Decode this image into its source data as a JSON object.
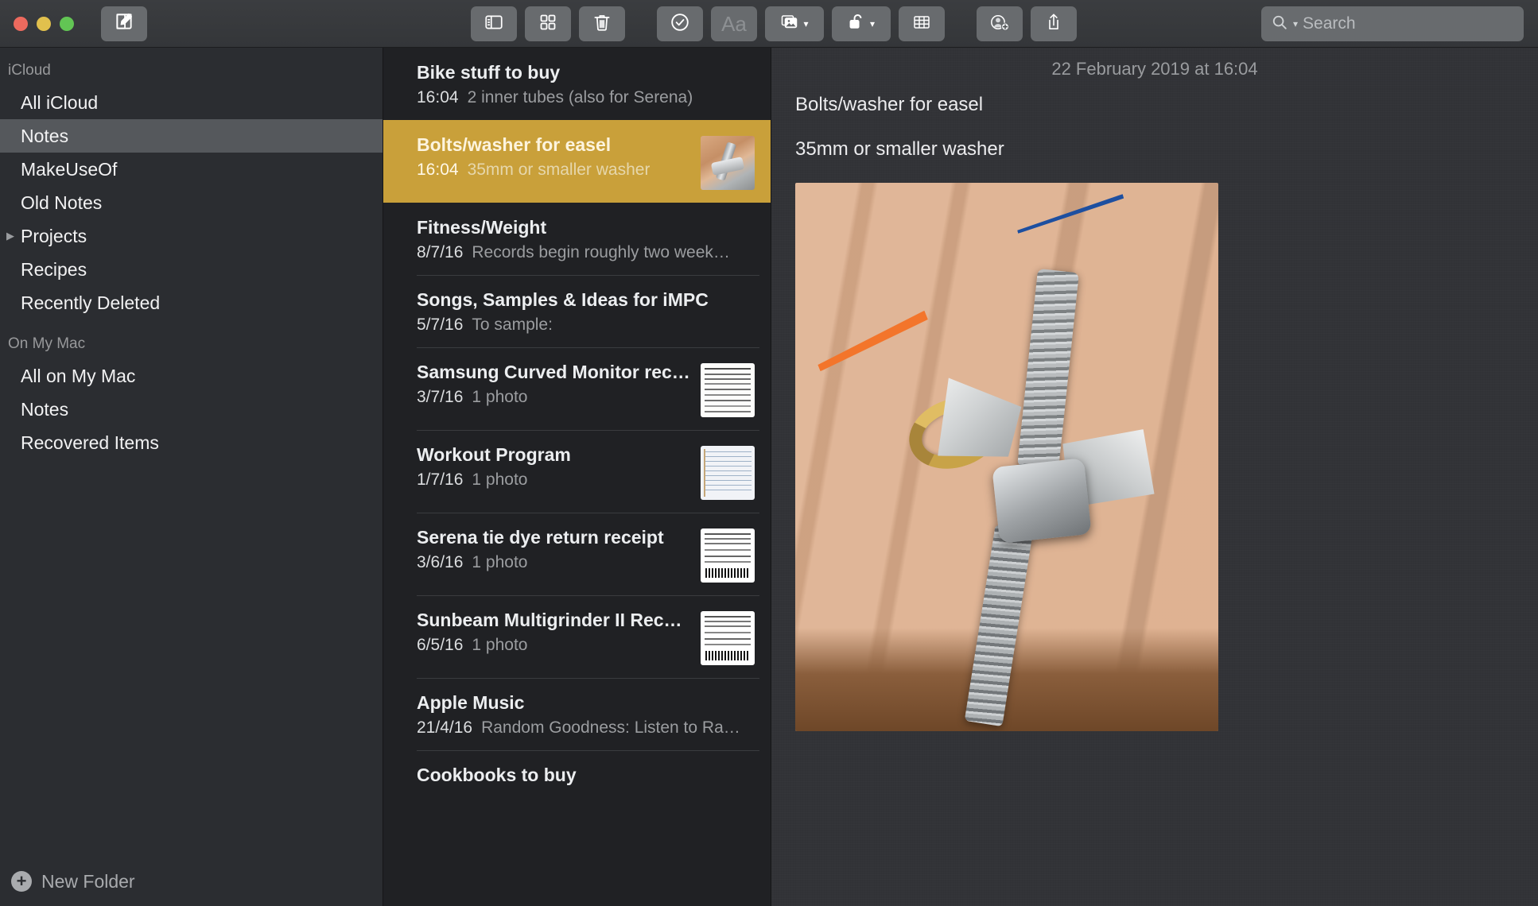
{
  "window": {
    "title": "Notes",
    "traffic_lights": [
      "close",
      "minimize",
      "zoom"
    ],
    "colors": {
      "selection_amber": "#c9a03a",
      "sidebar_selection": "#55585c",
      "toolbar_button": "#686b6e",
      "close": "#ed6a5e",
      "minimize": "#e1c04d",
      "zoom": "#62c554"
    }
  },
  "toolbar": {
    "compose_label": "compose-note-icon",
    "buttons": [
      {
        "name": "sidebar-toggle",
        "icon": "sidebar-icon",
        "enabled": true
      },
      {
        "name": "gallery-view",
        "icon": "grid-icon",
        "enabled": true
      },
      {
        "name": "delete-note",
        "icon": "trash-icon",
        "enabled": true
      },
      {
        "name": "checklist",
        "icon": "check-circle-icon",
        "enabled": true
      },
      {
        "name": "format-text",
        "icon": "aa-icon",
        "label": "Aa",
        "enabled": false
      },
      {
        "name": "insert-media",
        "icon": "photo-icon",
        "enabled": true,
        "has_menu": true
      },
      {
        "name": "lock-note",
        "icon": "lock-icon",
        "enabled": true,
        "has_menu": true
      },
      {
        "name": "insert-table",
        "icon": "table-icon",
        "enabled": true
      },
      {
        "name": "add-people",
        "icon": "add-person-icon",
        "enabled": true
      },
      {
        "name": "share-note",
        "icon": "share-icon",
        "enabled": true
      }
    ],
    "search": {
      "placeholder": "Search",
      "value": ""
    }
  },
  "sidebar": {
    "sections": [
      {
        "header": "iCloud",
        "items": [
          {
            "label": "All iCloud",
            "selected": false,
            "disclosure": false
          },
          {
            "label": "Notes",
            "selected": true,
            "disclosure": false
          },
          {
            "label": "MakeUseOf",
            "selected": false,
            "disclosure": false
          },
          {
            "label": "Old Notes",
            "selected": false,
            "disclosure": false
          },
          {
            "label": "Projects",
            "selected": false,
            "disclosure": true
          },
          {
            "label": "Recipes",
            "selected": false,
            "disclosure": false
          },
          {
            "label": "Recently Deleted",
            "selected": false,
            "disclosure": false
          }
        ]
      },
      {
        "header": "On My Mac",
        "items": [
          {
            "label": "All on My Mac",
            "selected": false,
            "disclosure": false
          },
          {
            "label": "Notes",
            "selected": false,
            "disclosure": false
          },
          {
            "label": "Recovered Items",
            "selected": false,
            "disclosure": false
          }
        ]
      }
    ],
    "new_folder_label": "New Folder"
  },
  "notes_list": [
    {
      "title": "Bike stuff to buy",
      "date": "16:04",
      "snippet": "2 inner tubes (also for Serena)",
      "selected": false,
      "thumb": null
    },
    {
      "title": "Bolts/washer for easel",
      "date": "16:04",
      "snippet": "35mm or smaller washer",
      "selected": true,
      "thumb": "photo"
    },
    {
      "title": "Fitness/Weight",
      "date": "8/7/16",
      "snippet": "Records begin roughly two weeks af…",
      "selected": false,
      "thumb": null
    },
    {
      "title": "Songs, Samples & Ideas for iMPC",
      "date": "5/7/16",
      "snippet": "To sample:",
      "selected": false,
      "thumb": null
    },
    {
      "title": "Samsung Curved Monitor rece…",
      "date": "3/7/16",
      "snippet": "1 photo",
      "selected": false,
      "thumb": "receipt"
    },
    {
      "title": "Workout Program",
      "date": "1/7/16",
      "snippet": "1 photo",
      "selected": false,
      "thumb": "notebook"
    },
    {
      "title": "Serena tie dye return receipt",
      "date": "3/6/16",
      "snippet": "1 photo",
      "selected": false,
      "thumb": "barcode"
    },
    {
      "title": "Sunbeam Multigrinder II Receipt",
      "date": "6/5/16",
      "snippet": "1 photo",
      "selected": false,
      "thumb": "barcode"
    },
    {
      "title": "Apple Music",
      "date": "21/4/16",
      "snippet": "Random Goodness: Listen to Rand…",
      "selected": false,
      "thumb": null
    },
    {
      "title": "Cookbooks to buy",
      "date": "",
      "snippet": "",
      "selected": false,
      "thumb": null
    }
  ],
  "detail": {
    "date_header": "22 February 2019 at 16:04",
    "lines": [
      "Bolts/washer for easel",
      "35mm or smaller washer"
    ],
    "attachment": {
      "name": "wing-bolt-photo",
      "description": "Photograph of a hand holding a stainless wing bolt and washer"
    }
  }
}
